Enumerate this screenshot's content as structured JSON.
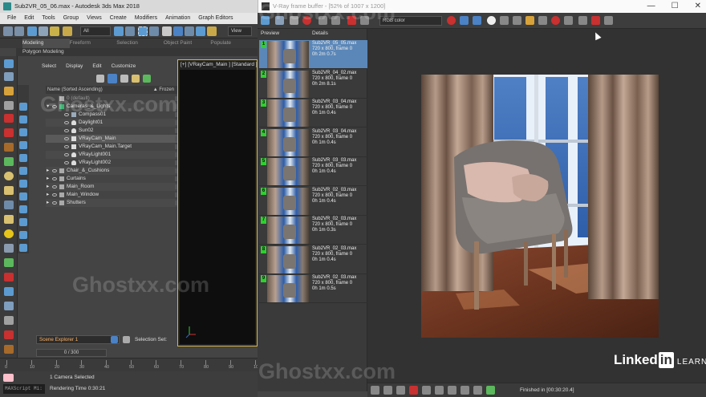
{
  "max_window": {
    "title": "Sub2VR_05_06.max - Autodesk 3ds Max 2018",
    "menu": [
      "File",
      "Edit",
      "Tools",
      "Group",
      "Views",
      "Create",
      "Modifiers",
      "Animation",
      "Graph Editors"
    ],
    "toolbar": {
      "selection_filter": "All",
      "ref_coord": "View"
    },
    "ribbon_tabs": [
      "Modeling",
      "Freeform",
      "Selection",
      "Object Paint",
      "Populate"
    ],
    "ribbon_active": "Modeling",
    "ribbon_panel": "Polygon Modeling"
  },
  "scene_explorer": {
    "menu": [
      "Select",
      "Display",
      "Edit",
      "Customize"
    ],
    "column_name": "Name (Sorted Ascending)",
    "column_frozen": "▲ Frozen",
    "rows": [
      {
        "label": "0 (default)",
        "indent": 0,
        "expander": "",
        "icon": "layer",
        "dim": true
      },
      {
        "label": "Cameras_&_Lights",
        "indent": 0,
        "expander": "▾",
        "icon": "layer-green"
      },
      {
        "label": "Compass01",
        "indent": 1,
        "expander": "",
        "icon": "helper"
      },
      {
        "label": "Daylight01",
        "indent": 1,
        "expander": "",
        "icon": "light"
      },
      {
        "label": "Sun02",
        "indent": 1,
        "expander": "",
        "icon": "light"
      },
      {
        "label": "VRayCam_Main",
        "indent": 1,
        "expander": "",
        "icon": "camera",
        "selected": true
      },
      {
        "label": "VRayCam_Main.Target",
        "indent": 1,
        "expander": "",
        "icon": "target"
      },
      {
        "label": "VRayLight001",
        "indent": 1,
        "expander": "",
        "icon": "light"
      },
      {
        "label": "VRayLight002",
        "indent": 1,
        "expander": "",
        "icon": "light"
      },
      {
        "label": "Chair_&_Cushions",
        "indent": 0,
        "expander": "▸",
        "icon": "layer"
      },
      {
        "label": "Curtains",
        "indent": 0,
        "expander": "▸",
        "icon": "layer"
      },
      {
        "label": "Main_Room",
        "indent": 0,
        "expander": "▸",
        "icon": "layer"
      },
      {
        "label": "Main_Window",
        "indent": 0,
        "expander": "▸",
        "icon": "layer"
      },
      {
        "label": "Shutters",
        "indent": 0,
        "expander": "▸",
        "icon": "layer"
      }
    ],
    "explorer_name": "Scene Explorer 1",
    "selection_set_label": "Selection Set:"
  },
  "viewport": {
    "label": "[+] [VRayCam_Main ] [Standard ] [Default Shading ]"
  },
  "timeline": {
    "slider": "0 / 300",
    "ticks": [
      "0",
      "10",
      "20",
      "30",
      "40",
      "50",
      "60",
      "70",
      "80",
      "90",
      "100"
    ]
  },
  "status": {
    "selection": "1 Camera Selected",
    "render_time": "Rendering Time  0:30:21",
    "maxscript": "MAXScript Mi:"
  },
  "vfb": {
    "title": "V-Ray frame buffer - [52% of 1007 x 1200]",
    "color_mode": "RGB color",
    "history_header_preview": "Preview",
    "history_header_details": "Details",
    "history": [
      {
        "num": "1",
        "file": "Sub2VR_05_05.max",
        "res": "720 x 800, frame 0",
        "time": "0h 2m 0.7s",
        "selected": true
      },
      {
        "num": "2",
        "file": "Sub2VR_04_02.max",
        "res": "720 x 800, frame 0",
        "time": "0h 2m 8.1s"
      },
      {
        "num": "3",
        "file": "Sub2VR_03_04.max",
        "res": "720 x 800, frame 0",
        "time": "0h 1m 0.4s"
      },
      {
        "num": "4",
        "file": "Sub2VR_03_04.max",
        "res": "720 x 800, frame 0",
        "time": "0h 1m 0.4s"
      },
      {
        "num": "5",
        "file": "Sub2VR_03_03.max",
        "res": "720 x 800, frame 0",
        "time": "0h 1m 0.4s"
      },
      {
        "num": "6",
        "file": "Sub2VR_02_03.max",
        "res": "720 x 800, frame 0",
        "time": "0h 1m 0.4s"
      },
      {
        "num": "7",
        "file": "Sub2VR_02_03.max",
        "res": "720 x 800, frame 0",
        "time": "0h 1m 0.3s"
      },
      {
        "num": "8",
        "file": "Sub2VR_02_03.max",
        "res": "720 x 800, frame 0",
        "time": "0h 1m 0.4s"
      },
      {
        "num": "9",
        "file": "Sub2VR_02_03.max",
        "res": "720 x 800, frame 0",
        "time": "0h 1m 0.5s"
      }
    ],
    "status": "Finished in [00:30:20.4]"
  },
  "watermark": "Ghostxx.com",
  "branding": {
    "linked": "Linked",
    "in": "in",
    "learning": "LEARNING"
  }
}
